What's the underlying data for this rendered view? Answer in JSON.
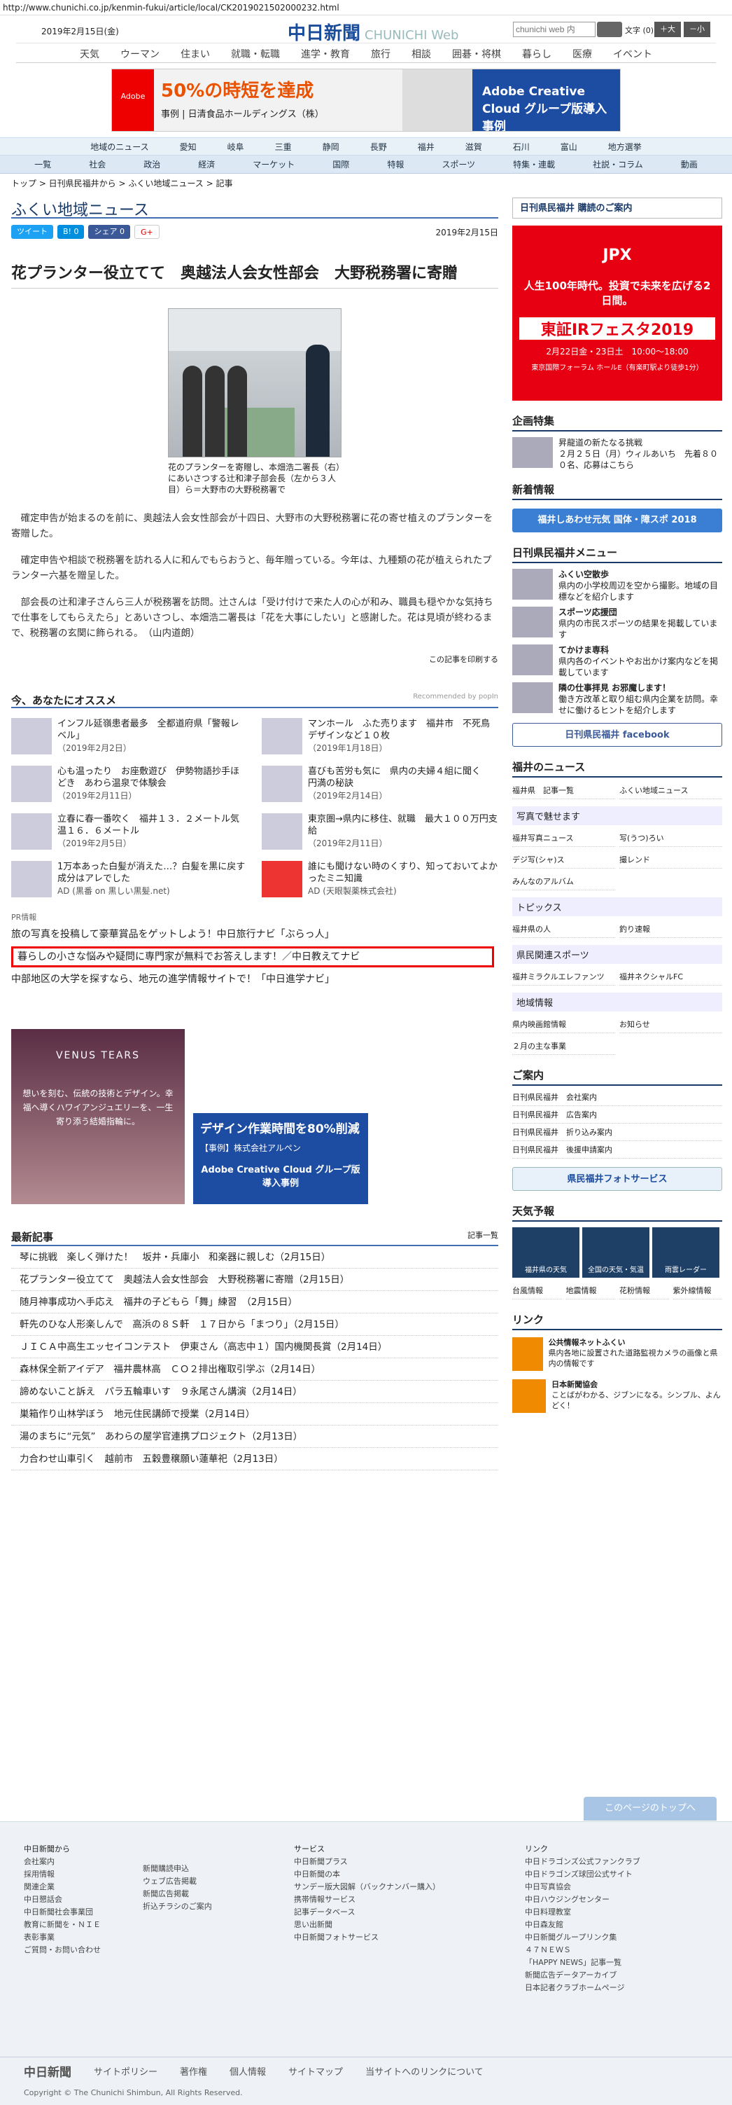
{
  "url": "http://www.chunichi.co.jp/kenmin-fukui/article/local/CK2019021502000232.html",
  "header": {
    "date": "2019年2月15日(金)",
    "logo": "中日新聞",
    "logo_sub": "CHUNICHI Web",
    "search_placeholder": "chunichi web 内",
    "fontsize": "文字 (0)",
    "big": "＋大",
    "small": "－小"
  },
  "gnav": [
    "天気",
    "ウーマン",
    "住まい",
    "就職・転職",
    "進学・教育",
    "旅行",
    "相談",
    "囲碁・将棋",
    "暮らし",
    "医療",
    "イベント"
  ],
  "ad_top": {
    "brand": "Adobe",
    "headline": "50%の時短を達成",
    "sub": "事例 | 日清食品ホールディングス（株）",
    "blue": "Adobe Creative Cloud グループ版導入事例"
  },
  "areanav": [
    "地域のニュース",
    "愛知",
    "岐阜",
    "三重",
    "静岡",
    "長野",
    "福井",
    "滋賀",
    "石川",
    "富山",
    "地方選挙"
  ],
  "catnav": [
    "一覧",
    "社会",
    "政治",
    "経済",
    "マーケット",
    "国際",
    "特報",
    "スポーツ",
    "特集・連載",
    "社説・コラム",
    "動画"
  ],
  "breadcrumb": "トップ > 日刊県民福井から > ふくい地域ニュース > 記事",
  "section_title": "ふくい地域ニュース",
  "share": {
    "tweet": "ツイート",
    "b": "B! 0",
    "fb": "シェア 0",
    "g": "G+"
  },
  "article": {
    "date": "2019年2月15日",
    "headline": "花プランター役立てて　奥越法人会女性部会　大野税務署に寄贈",
    "caption": "花のプランターを寄贈し、本畑浩二署長（右）にあいさつする辻和津子部会長（左から３人目）ら＝大野市の大野税務署で",
    "paras": [
      "確定申告が始まるのを前に、奥越法人会女性部会が十四日、大野市の大野税務署に花の寄せ植えのプランターを寄贈した。",
      "確定申告や相談で税務署を訪れる人に和んでもらおうと、毎年贈っている。今年は、九種類の花が植えられたプランター六基を贈呈した。",
      "部会長の辻和津子さんら三人が税務署を訪問。辻さんは「受け付けで来た人の心が和み、職員も穏やかな気持ちで仕事をしてもらえたら」とあいさつし、本畑浩二署長は「花を大事にしたい」と感謝した。花は見頃が終わるまで、税務署の玄関に飾られる。　（山内道朗）"
    ],
    "print": "この記事を印刷する"
  },
  "recommend": {
    "title": "今、あなたにオススメ",
    "by": "Recommended by popIn",
    "items": [
      {
        "t": "インフル延嶺患者最多　全都道府県「警報レベル」",
        "d": "（2019年2月2日）"
      },
      {
        "t": "マンホール　ふた売ります　福井市　不死鳥デザインなど１０枚",
        "d": "（2019年1月18日）"
      },
      {
        "t": "心も温ったり　お座敷遊び　伊勢物語抄手ほどき　あわら温泉で体験会",
        "d": "（2019年2月11日）"
      },
      {
        "t": "喜びも苦労も気に　県内の夫婦４組に聞く　円満の秘訣",
        "d": "（2019年2月14日）"
      },
      {
        "t": "立春に春一番吹く　福井１３．２メートル気温１６．６メートル",
        "d": "（2019年2月5日）"
      },
      {
        "t": "東京圏→県内に移住、就職　最大１００万円支給",
        "d": "（2019年2月11日）"
      },
      {
        "t": "1万本あった白髪が消えた…？白髪を黒に戻す成分はアレでした",
        "d": "AD (黒番 on 黒しい黒髪.net)"
      },
      {
        "t": "誰にも聞けない時のくすり、知っておいてよかったミニ知識",
        "d": "AD (天眼製薬株式会社)"
      }
    ]
  },
  "pr": {
    "label": "PR情報",
    "lines": [
      "旅の写真を投稿して豪華賞品をゲットしよう！中日旅行ナビ「ぶらっ人」",
      "暮らしの小さな悩みや疑問に専門家が無料でお答えします！／中日教えてナビ",
      "中部地区の大学を探すなら、地元の進学情報サイトで！「中日進学ナビ」"
    ]
  },
  "banners": {
    "venus_brand": "VENUS TEARS",
    "venus_text": "想いを刻む、伝統の技術とデザイン。幸福へ導くハワイアンジュエリーを、一生寄り添う結婚指輪に。",
    "adobe_text": "デザイン作業時間を80%削減",
    "adobe_case": "【事例】株式会社アルペン",
    "adobe_blue": "Adobe Creative Cloud グループ版導入事例"
  },
  "latest": {
    "title": "最新記事",
    "more": "記事一覧",
    "items": [
      "琴に挑戦　楽しく弾けた！　坂井・兵庫小　和楽器に親しむ（2月15日）",
      "花プランター役立てて　奥越法人会女性部会　大野税務署に寄贈（2月15日）",
      "随月神事成功へ手応え　福井の子どもら「舞」練習　（2月15日）",
      "軒先のひな人形楽しんで　高浜の８Ｓ軒　１７日から「まつり」（2月15日）",
      "ＪＩＣＡ中高生エッセイコンテスト　伊東さん（高志中１）国内機関長賞（2月14日）",
      "森林保全新アイデア　福井農林高　ＣＯ２排出権取引学ぶ（2月14日）",
      "諦めないこと訴え　パラ五輪車いす　９永尾さん講演（2月14日）",
      "巣箱作り山林学ぼう　地元住民講師で授業（2月14日）",
      "湯のまちに“元気”　あわらの屋学官連携プロジェクト（2月13日）",
      "力合わせ山車引く　越前市　五穀豊穣願い蓮華祀（2月13日）"
    ]
  },
  "side": {
    "kodoku": "日刊県民福井 購読のご案内",
    "jpx": {
      "brand": "JPX",
      "line1": "人生100年時代。投資で未来を広げる2日間。",
      "fes": "東証IRフェスタ2019",
      "date": "2月22日金・23日土　10:00〜18:00",
      "venue": "東京国際フォーラム ホールE（有楽町駅より徒歩1分）"
    },
    "kigyo": {
      "title": "企画特集",
      "item_t": "昇龍道の新たなる挑戦",
      "item_d": "２月２５日（月）ウィルあいち　先着８００名、応募はこちら"
    },
    "shinsai": {
      "title": "新着情報",
      "banner": "福井しあわせ元気 国体・障スポ 2018"
    },
    "menu": {
      "title": "日刊県民福井メニュー",
      "items": [
        {
          "t": "ふくい空散歩",
          "d": "県内の小学校周辺を空から撮影。地域の目標などを紹介します"
        },
        {
          "t": "スポーツ応援団",
          "d": "県内の市民スポーツの結果を掲載しています"
        },
        {
          "t": "てかけま専科",
          "d": "県内各のイベントやお出かけ案内などを掲載しています"
        },
        {
          "t": "隣の仕事拝見 お邪魔します！",
          "d": "働き方改革と取り組む県内企業を訪問。幸せに働けるヒントを紹介します"
        }
      ],
      "fb": "日刊県民福井 facebook"
    },
    "fukui_news": {
      "title": "福井のニュース",
      "links": [
        "福井県　記事一覧",
        "ふくい地域ニュース"
      ],
      "photo_h": "写真で魅せます",
      "photo": [
        "福井写真ニュース",
        "写(うつ)ろい",
        "デジ写(シャ)ス",
        "撮レンド",
        "みんなのアルバム"
      ],
      "topics_h": "トピックス",
      "topics": [
        "福井県の人",
        "釣り速報"
      ],
      "sports_h": "県民関連スポーツ",
      "sports": [
        "福井ミラクルエレファンツ",
        "福井ネクシャルFC"
      ],
      "local_h": "地域情報",
      "local": [
        "県内映画館情報",
        "お知らせ",
        "２月の主な事業"
      ]
    },
    "annai": {
      "title": "ご案内",
      "items": [
        "日刊県民福井　会社案内",
        "日刊県民福井　広告案内",
        "日刊県民福井　折り込み案内",
        "日刊県民福井　後援申請案内"
      ]
    },
    "photo_service": "県民福井フォトサービス",
    "weather": {
      "title": "天気予報",
      "boxes": [
        "福井県の天気",
        "全国の天気・気温",
        "雨雲レーダー"
      ],
      "links": [
        "台風情報",
        "地震情報",
        "花粉情報",
        "紫外線情報"
      ]
    },
    "link": {
      "title": "リンク",
      "items": [
        {
          "t": "公共情報ネットふくい",
          "d": "県内各地に設置された道路監視カメラの画像と県内の情報です"
        },
        {
          "t": "日本新聞協会",
          "d": "ことばがわかる、ジブンになる。シンプル、よんどく！"
        }
      ]
    }
  },
  "totop": "このページのトップへ",
  "footer": {
    "c1_title": "中日新聞から",
    "c1": [
      "会社案内",
      "採用情報",
      "関連企業",
      "中日懇話会",
      "中日新聞社会事業団",
      "教育に新聞を・ＮＩＥ",
      "表彰事業",
      "ご質問・お問い合わせ"
    ],
    "c2": [
      "新聞購読申込",
      "ウェブ広告掲載",
      "新聞広告掲載",
      "折込チラシのご案内"
    ],
    "c3_title": "サービス",
    "c3": [
      "中日新聞プラス",
      "中日新聞の本",
      "サンデー版大図解（バックナンバー購入）",
      "携帯情報サービス",
      "記事データベース",
      "思い出新聞",
      "中日新聞フォトサービス"
    ],
    "c4_title": "リンク",
    "c4": [
      "中日ドラゴンズ公式ファンクラブ",
      "中日ドラゴンズ球団公式サイト",
      "中日写真協会",
      "中日ハウジングセンター",
      "中日料理教室",
      "中日森友館",
      "中日新聞グループリンク集",
      "４７ＮＥＷＳ",
      "「HAPPY NEWS」記事一覧",
      "新聞広告データアーカイブ",
      "日本記者クラブホームページ"
    ],
    "bar": [
      "中日新聞",
      "サイトポリシー",
      "著作権",
      "個人情報",
      "サイトマップ",
      "当サイトへのリンクについて"
    ],
    "copy": "Copyright © The Chunichi Shimbun, All Rights Reserved."
  }
}
